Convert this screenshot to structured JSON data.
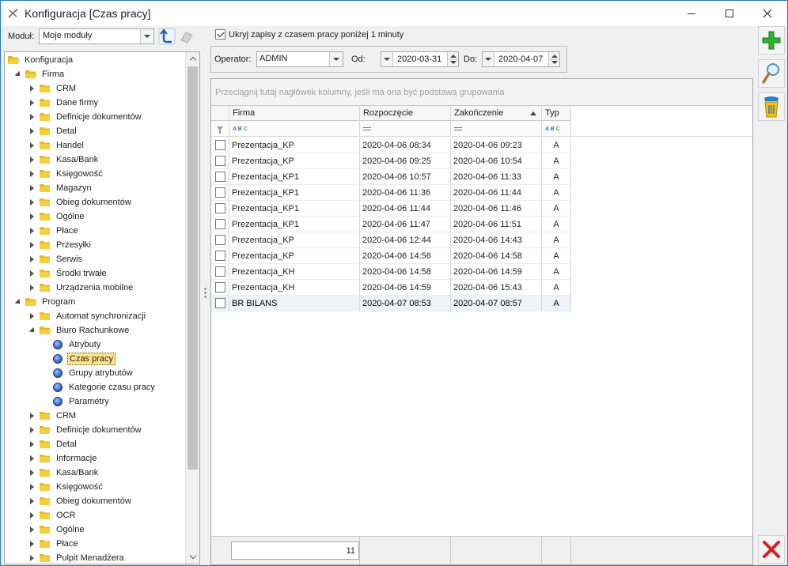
{
  "window": {
    "title": "Konfiguracja [Czas pracy]"
  },
  "module": {
    "label": "Moduł:",
    "selected": "Moje moduły"
  },
  "tree": {
    "items": [
      {
        "label": "Konfiguracja",
        "level": 0,
        "expander": "none",
        "icon": "folder-open-icon"
      },
      {
        "label": "Firma",
        "level": 1,
        "expander": "down",
        "icon": "folder-open-icon"
      },
      {
        "label": "CRM",
        "level": 2,
        "expander": "right",
        "icon": "folder-icon"
      },
      {
        "label": "Dane firmy",
        "level": 2,
        "expander": "right",
        "icon": "folder-icon"
      },
      {
        "label": "Definicje dokumentów",
        "level": 2,
        "expander": "right",
        "icon": "folder-icon"
      },
      {
        "label": "Detal",
        "level": 2,
        "expander": "right",
        "icon": "folder-icon"
      },
      {
        "label": "Handel",
        "level": 2,
        "expander": "right",
        "icon": "folder-icon"
      },
      {
        "label": "Kasa/Bank",
        "level": 2,
        "expander": "right",
        "icon": "folder-icon"
      },
      {
        "label": "Księgowość",
        "level": 2,
        "expander": "right",
        "icon": "folder-icon"
      },
      {
        "label": "Magazyn",
        "level": 2,
        "expander": "right",
        "icon": "folder-icon"
      },
      {
        "label": "Obieg dokumentów",
        "level": 2,
        "expander": "right",
        "icon": "folder-icon"
      },
      {
        "label": "Ogólne",
        "level": 2,
        "expander": "right",
        "icon": "folder-icon"
      },
      {
        "label": "Płace",
        "level": 2,
        "expander": "right",
        "icon": "folder-icon"
      },
      {
        "label": "Przesyłki",
        "level": 2,
        "expander": "right",
        "icon": "folder-icon"
      },
      {
        "label": "Serwis",
        "level": 2,
        "expander": "right",
        "icon": "folder-icon"
      },
      {
        "label": "Środki trwałe",
        "level": 2,
        "expander": "right",
        "icon": "folder-icon"
      },
      {
        "label": "Urządzenia mobilne",
        "level": 2,
        "expander": "right",
        "icon": "folder-icon"
      },
      {
        "label": "Program",
        "level": 1,
        "expander": "down",
        "icon": "folder-open-icon"
      },
      {
        "label": "Automat synchronizacji",
        "level": 2,
        "expander": "right",
        "icon": "folder-icon"
      },
      {
        "label": "Biuro Rachunkowe",
        "level": 2,
        "expander": "down",
        "icon": "folder-open-icon"
      },
      {
        "label": "Atrybuty",
        "level": 3,
        "expander": "none",
        "icon": "leaf-icon"
      },
      {
        "label": "Czas pracy",
        "level": 3,
        "expander": "none",
        "icon": "leaf-icon",
        "selected": true
      },
      {
        "label": "Grupy atrybutów",
        "level": 3,
        "expander": "none",
        "icon": "leaf-icon"
      },
      {
        "label": "Kategorie czasu pracy",
        "level": 3,
        "expander": "none",
        "icon": "leaf-icon"
      },
      {
        "label": "Parametry",
        "level": 3,
        "expander": "none",
        "icon": "leaf-icon"
      },
      {
        "label": "CRM",
        "level": 2,
        "expander": "right",
        "icon": "folder-icon"
      },
      {
        "label": "Definicje dokumentów",
        "level": 2,
        "expander": "right",
        "icon": "folder-icon"
      },
      {
        "label": "Detal",
        "level": 2,
        "expander": "right",
        "icon": "folder-icon"
      },
      {
        "label": "Informacje",
        "level": 2,
        "expander": "right",
        "icon": "folder-icon"
      },
      {
        "label": "Kasa/Bank",
        "level": 2,
        "expander": "right",
        "icon": "folder-icon"
      },
      {
        "label": "Księgowość",
        "level": 2,
        "expander": "right",
        "icon": "folder-icon"
      },
      {
        "label": "Obieg dokumentów",
        "level": 2,
        "expander": "right",
        "icon": "folder-icon"
      },
      {
        "label": "OCR",
        "level": 2,
        "expander": "right",
        "icon": "folder-icon"
      },
      {
        "label": "Ogólne",
        "level": 2,
        "expander": "right",
        "icon": "folder-icon"
      },
      {
        "label": "Płace",
        "level": 2,
        "expander": "right",
        "icon": "folder-icon"
      },
      {
        "label": "Pulpit Menadżera",
        "level": 2,
        "expander": "right",
        "icon": "folder-icon"
      }
    ]
  },
  "filters": {
    "hide_short_label": "Ukryj zapisy z czasem pracy poniżej 1 minuty",
    "hide_short_checked": true,
    "operator_label": "Operator:",
    "operator_value": "ADMIN",
    "od_label": "Od:",
    "od_value": "2020-03-31",
    "do_label": "Do:",
    "do_value": "2020-04-07"
  },
  "grid": {
    "group_hint": "Przeciągnij tutaj nagłówek kolumny, jeśli ma ona być podstawą grupowania",
    "columns": {
      "firma": "Firma",
      "start": "Rozpoczęcie",
      "end": "Zakończenie",
      "type": "Typ"
    },
    "rows": [
      {
        "firma": "Prezentacja_KP",
        "start": "2020-04-06 08:34",
        "end": "2020-04-06 09:23",
        "type": "A"
      },
      {
        "firma": "Prezentacja_KP",
        "start": "2020-04-06 09:25",
        "end": "2020-04-06 10:54",
        "type": "A"
      },
      {
        "firma": "Prezentacja_KP1",
        "start": "2020-04-06 10:57",
        "end": "2020-04-06 11:33",
        "type": "A"
      },
      {
        "firma": "Prezentacja_KP1",
        "start": "2020-04-06 11:36",
        "end": "2020-04-06 11:44",
        "type": "A"
      },
      {
        "firma": "Prezentacja_KP1",
        "start": "2020-04-06 11:44",
        "end": "2020-04-06 11:46",
        "type": "A"
      },
      {
        "firma": "Prezentacja_KP1",
        "start": "2020-04-06 11:47",
        "end": "2020-04-06 11:51",
        "type": "A"
      },
      {
        "firma": "Prezentacja_KP",
        "start": "2020-04-06 12:44",
        "end": "2020-04-06 14:43",
        "type": "A"
      },
      {
        "firma": "Prezentacja_KP",
        "start": "2020-04-06 14:56",
        "end": "2020-04-06 14:58",
        "type": "A"
      },
      {
        "firma": "Prezentacja_KH",
        "start": "2020-04-06 14:58",
        "end": "2020-04-06 14:59",
        "type": "A"
      },
      {
        "firma": "Prezentacja_KH",
        "start": "2020-04-06 14:59",
        "end": "2020-04-06 15:43",
        "type": "A"
      },
      {
        "firma": "BR BILANS",
        "start": "2020-04-07 08:53",
        "end": "2020-04-07 08:57",
        "type": "A",
        "selected": true
      }
    ],
    "count": "11"
  },
  "toolbar": {
    "add_icon": "plus-icon",
    "preview_icon": "magnifier-icon",
    "delete_icon": "trash-icon",
    "close_icon": "close-x-icon"
  },
  "colors": {
    "window_border": "#2b79c8",
    "selection_yellow": "#ffe48c",
    "folder_yellow": "#f5cf3c",
    "add_green": "#2fb02f",
    "close_red": "#d32020"
  }
}
